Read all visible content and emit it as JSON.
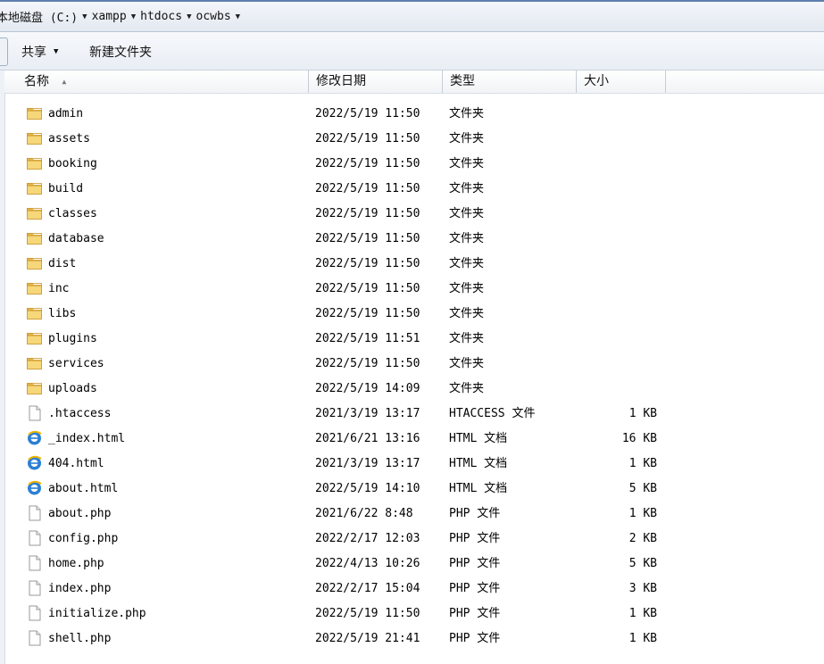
{
  "address": {
    "crumbs": [
      "本地磁盘 (C:)",
      "xampp",
      "htdocs",
      "ocwbs"
    ]
  },
  "toolbar": {
    "share_label": "共享",
    "new_folder_label": "新建文件夹"
  },
  "columns": {
    "name": "名称",
    "date": "修改日期",
    "type": "类型",
    "size": "大小"
  },
  "files": [
    {
      "name": "admin",
      "date": "2022/5/19 11:50",
      "type": "文件夹",
      "size": "",
      "icon": "folder-icon"
    },
    {
      "name": "assets",
      "date": "2022/5/19 11:50",
      "type": "文件夹",
      "size": "",
      "icon": "folder-icon"
    },
    {
      "name": "booking",
      "date": "2022/5/19 11:50",
      "type": "文件夹",
      "size": "",
      "icon": "folder-icon"
    },
    {
      "name": "build",
      "date": "2022/5/19 11:50",
      "type": "文件夹",
      "size": "",
      "icon": "folder-icon"
    },
    {
      "name": "classes",
      "date": "2022/5/19 11:50",
      "type": "文件夹",
      "size": "",
      "icon": "folder-icon"
    },
    {
      "name": "database",
      "date": "2022/5/19 11:50",
      "type": "文件夹",
      "size": "",
      "icon": "folder-icon"
    },
    {
      "name": "dist",
      "date": "2022/5/19 11:50",
      "type": "文件夹",
      "size": "",
      "icon": "folder-icon"
    },
    {
      "name": "inc",
      "date": "2022/5/19 11:50",
      "type": "文件夹",
      "size": "",
      "icon": "folder-icon"
    },
    {
      "name": "libs",
      "date": "2022/5/19 11:50",
      "type": "文件夹",
      "size": "",
      "icon": "folder-icon"
    },
    {
      "name": "plugins",
      "date": "2022/5/19 11:51",
      "type": "文件夹",
      "size": "",
      "icon": "folder-icon"
    },
    {
      "name": "services",
      "date": "2022/5/19 11:50",
      "type": "文件夹",
      "size": "",
      "icon": "folder-icon"
    },
    {
      "name": "uploads",
      "date": "2022/5/19 14:09",
      "type": "文件夹",
      "size": "",
      "icon": "folder-icon"
    },
    {
      "name": ".htaccess",
      "date": "2021/3/19 13:17",
      "type": "HTACCESS 文件",
      "size": "1 KB",
      "icon": "file-icon"
    },
    {
      "name": "_index.html",
      "date": "2021/6/21 13:16",
      "type": "HTML 文档",
      "size": "16 KB",
      "icon": "html-icon"
    },
    {
      "name": "404.html",
      "date": "2021/3/19 13:17",
      "type": "HTML 文档",
      "size": "1 KB",
      "icon": "html-icon"
    },
    {
      "name": "about.html",
      "date": "2022/5/19 14:10",
      "type": "HTML 文档",
      "size": "5 KB",
      "icon": "html-icon"
    },
    {
      "name": "about.php",
      "date": "2021/6/22 8:48",
      "type": "PHP 文件",
      "size": "1 KB",
      "icon": "file-icon"
    },
    {
      "name": "config.php",
      "date": "2022/2/17 12:03",
      "type": "PHP 文件",
      "size": "2 KB",
      "icon": "file-icon"
    },
    {
      "name": "home.php",
      "date": "2022/4/13 10:26",
      "type": "PHP 文件",
      "size": "5 KB",
      "icon": "file-icon"
    },
    {
      "name": "index.php",
      "date": "2022/2/17 15:04",
      "type": "PHP 文件",
      "size": "3 KB",
      "icon": "file-icon"
    },
    {
      "name": "initialize.php",
      "date": "2022/5/19 11:50",
      "type": "PHP 文件",
      "size": "1 KB",
      "icon": "file-icon"
    },
    {
      "name": "shell.php",
      "date": "2022/5/19 21:41",
      "type": "PHP 文件",
      "size": "1 KB",
      "icon": "file-icon"
    }
  ]
}
